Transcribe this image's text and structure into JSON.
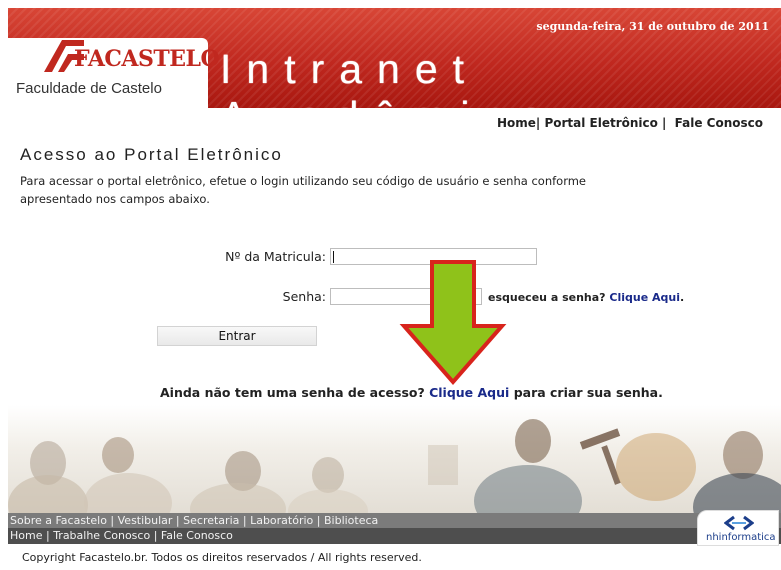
{
  "header": {
    "date": "segunda-feira, 31 de outubro de 2011",
    "logo_name": "FACASTELO",
    "logo_sub": "Faculdade de Castelo",
    "title": "Intranet Acadêmica"
  },
  "topnav": {
    "home": "Home|",
    "portal": "Portal Eletrônico |",
    "contact": "Fale Conosco"
  },
  "main": {
    "heading": "Acesso ao Portal Eletrônico",
    "intro": "Para acessar o portal eletrônico, efetue o login utilizando seu código de usuário e senha conforme apresentado nos campos abaixo."
  },
  "form": {
    "matricula_label": "Nº da Matricula:",
    "matricula_value": "",
    "senha_label": "Senha:",
    "senha_value": "",
    "forgot_text": "esqueceu a senha?",
    "forgot_link": "Clique Aqui",
    "forgot_period": ".",
    "submit_label": "Entrar"
  },
  "signup": {
    "prefix": "Ainda não tem uma senha de acesso?",
    "link": "Clique Aqui",
    "suffix": "para criar sua senha."
  },
  "footer": {
    "row1": [
      "Sobre a Facastelo",
      "Vestibular",
      "Secretaria",
      "Laboratório",
      "Biblioteca"
    ],
    "row2": [
      "Home",
      "Trabalhe Conosco",
      "Fale Conosco"
    ],
    "dev_logo_text": "nhinformatica",
    "copyright": "Copyright Facastelo.br. Todos os direitos reservados / All rights reserved."
  },
  "colors": {
    "brand_red": "#c0281f",
    "arrow_green": "#8fc21a",
    "arrow_border": "#d8241c",
    "link_blue": "#1a2a8a"
  },
  "icons": {
    "logo_mark": "facastelo-logo-mark",
    "arrow": "down-arrow-annotation",
    "dev_logo": "nh-informatica-logo"
  }
}
